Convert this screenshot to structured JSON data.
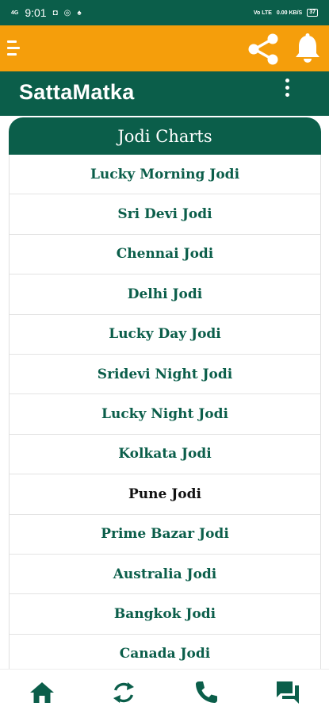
{
  "status_bar": {
    "time": "9:01",
    "network_left": "4G",
    "network_right": "Vo LTE",
    "speed": "0.00 KB/S",
    "battery": "37"
  },
  "toolbar": {
    "menu_icon": "hamburger-menu-icon",
    "share_icon": "share-icon",
    "bell_icon": "bell-icon"
  },
  "appbar": {
    "title": "SattaMatka",
    "overflow_icon": "more-vertical-icon"
  },
  "card": {
    "header": "Jodi Charts",
    "items": [
      "Lucky Morning Jodi",
      "Sri Devi Jodi",
      "Chennai Jodi",
      "Delhi Jodi",
      "Lucky Day Jodi",
      "Sridevi Night Jodi",
      "Lucky Night Jodi",
      "Kolkata Jodi",
      "Pune Jodi",
      "Prime Bazar Jodi",
      "Australia Jodi",
      "Bangkok Jodi",
      "Canada Jodi"
    ]
  },
  "bottom_nav": [
    "home-icon",
    "refresh-icon",
    "phone-icon",
    "chat-icon"
  ],
  "colors": {
    "primary": "#0b5e4a",
    "toolbar": "#f59e0b",
    "item_text": "#0b5e4a"
  }
}
